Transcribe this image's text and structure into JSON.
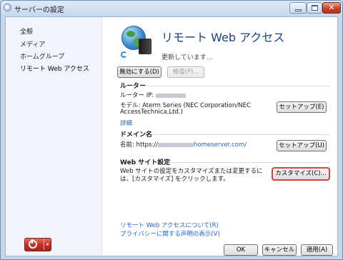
{
  "window": {
    "title": "サーバーの設定",
    "close_glyph": "✕"
  },
  "nav": {
    "items": [
      "全般",
      "メディア",
      "ホームグループ",
      "リモート Web アクセス"
    ],
    "selected": 3
  },
  "header": {
    "title": "リモート Web アクセス",
    "status": "更新しています..."
  },
  "actions": {
    "disable_label": "無効にする(D)",
    "repair_label": "修復(P)..."
  },
  "router": {
    "heading": "ルーター",
    "ip_label": "ルーター IP:",
    "model_line1": "モデル: Aterm Series (NEC Corporation/NEC",
    "model_line2": "AccessTechnica,Ltd.)",
    "details_link": "詳細",
    "setup_label": "セットアップ(E)"
  },
  "domain": {
    "heading": "ドメイン名",
    "name_prefix": "名前: https://",
    "name_suffix": "homeserver.com/",
    "setup_label": "セットアップ(U)"
  },
  "website": {
    "heading": "Web サイト設定",
    "desc_line1": "Web サイトの設定をカスタマイズまたは変更するに",
    "desc_line2": "は、[カスタマイズ] をクリックします。",
    "customize_label": "カスタマイズ(C)..."
  },
  "links": {
    "about": "リモート Web アクセスについて(R)",
    "privacy": "プライバシーに関する声明の表示(V)"
  },
  "footer": {
    "ok_label": "OK",
    "cancel_label": "キャンセル",
    "apply_label": "適用(A)"
  },
  "power": {
    "arrow": "▸"
  }
}
